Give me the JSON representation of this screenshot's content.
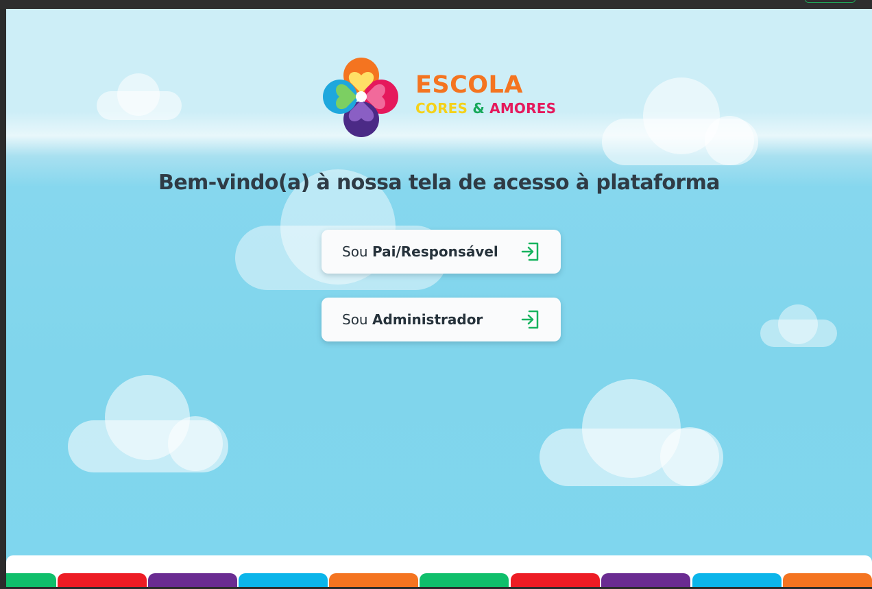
{
  "logo": {
    "line1": "ESCOLA",
    "cores": "CORES",
    "amp": "&",
    "amores": "AMORES"
  },
  "welcome": "Bem-vindo(a) à nossa tela de acesso à plataforma",
  "buttons": {
    "parent": {
      "prefix": "Sou ",
      "bold": "Pai/Responsável",
      "icon": "login-icon"
    },
    "admin": {
      "prefix": "Sou ",
      "bold": "Administrador",
      "icon": "login-icon"
    }
  },
  "colors": {
    "sky_top": "#cdeef7",
    "sky_bottom": "#7fd6ee",
    "title": "#2f3b45",
    "logo_orange": "#f47420",
    "logo_yellow": "#f4d11a",
    "logo_green": "#16a85a",
    "logo_pink": "#e5195c",
    "icon_green": "#16b35e"
  },
  "footer_tabs": [
    "#0fbf6b",
    "#ed1c24",
    "#6a2c91",
    "#0bb5ea",
    "#f47420",
    "#0fbf6b",
    "#ed1c24",
    "#6a2c91",
    "#0bb5ea",
    "#f47420"
  ]
}
